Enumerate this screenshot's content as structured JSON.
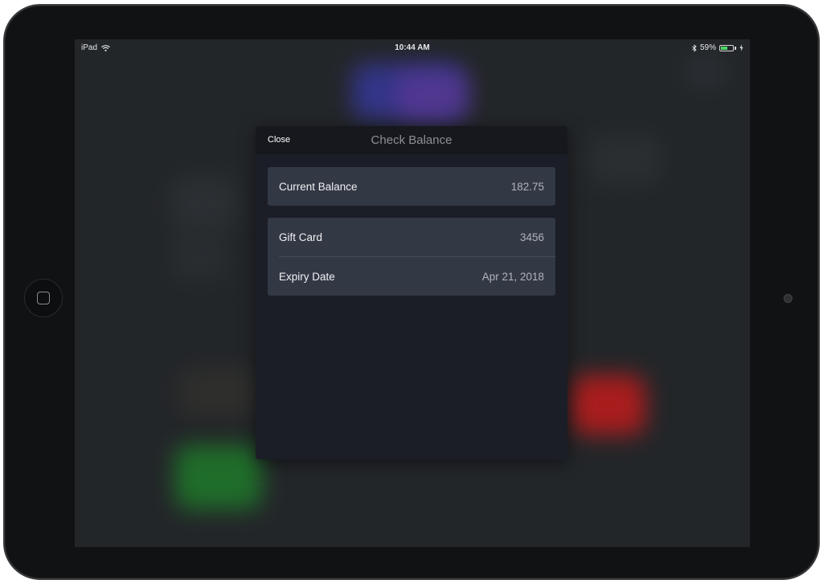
{
  "status_bar": {
    "device": "iPad",
    "time": "10:44 AM",
    "battery_percent": "59%",
    "battery_level": 0.59
  },
  "modal": {
    "close_label": "Close",
    "title": "Check Balance",
    "balance": {
      "label": "Current Balance",
      "value": "182.75"
    },
    "details": [
      {
        "label": "Gift Card",
        "value": "3456"
      },
      {
        "label": "Expiry Date",
        "value": "Apr 21, 2018"
      }
    ]
  },
  "icons": {
    "wifi": "wifi-icon",
    "bluetooth": "bluetooth-icon",
    "battery": "battery-icon",
    "charging": "charging-bolt-icon",
    "home": "home-button-icon"
  },
  "colors": {
    "modal_bg": "#1b1e26",
    "card_bg": "#333845",
    "battery_green": "#4cd964"
  }
}
